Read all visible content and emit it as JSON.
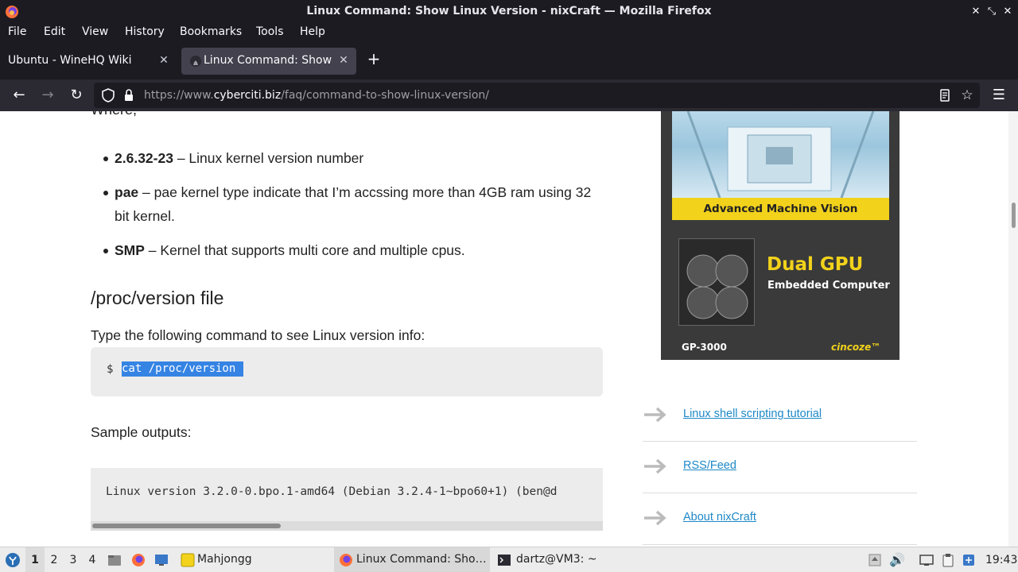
{
  "window": {
    "title": "Linux Command: Show Linux Version - nixCraft — Mozilla Firefox"
  },
  "menubar": {
    "items": [
      "File",
      "Edit",
      "View",
      "History",
      "Bookmarks",
      "Tools",
      "Help"
    ]
  },
  "tabs": [
    {
      "label": "Ubuntu - WineHQ Wiki",
      "active": false
    },
    {
      "label": "Linux Command: Show Linux Version - nixCraft",
      "active": true
    }
  ],
  "urlbar": {
    "prefix": "https://www.",
    "domain": "cyberciti.biz",
    "path": "/faq/command-to-show-linux-version/"
  },
  "article": {
    "cut_text": "Where,",
    "definitions": [
      {
        "term": "2.6.32-23",
        "desc": " – Linux kernel version number"
      },
      {
        "term": "pae",
        "desc": " – pae kernel type indicate that I’m accssing more than 4GB ram using 32 bit kernel."
      },
      {
        "term": "SMP",
        "desc": " – Kernel that supports multi core and multiple cpus."
      }
    ],
    "section_heading": "/proc/version file",
    "lead": "Type the following command to see Linux version info:",
    "prompt": "$",
    "command": "cat /proc/version",
    "sample_label": "Sample outputs:",
    "output": "Linux version 3.2.0-0.bpo.1-amd64 (Debian 3.2.4-1~bpo60+1) (ben@d"
  },
  "ad": {
    "banner": "Advanced Machine Vision",
    "headline": "Dual GPU",
    "subline": "Embedded Computer",
    "model": "GP-3000",
    "brand": "cincoze™"
  },
  "sidebar_links": [
    "Linux shell scripting tutorial",
    "RSS/Feed",
    "About nixCraft"
  ],
  "taskbar": {
    "workspaces": [
      "1",
      "2",
      "3",
      "4"
    ],
    "tasks": [
      {
        "label": "Mahjongg"
      },
      {
        "label": "Linux Command: Sho…"
      },
      {
        "label": "dartz@VM3: ~"
      }
    ],
    "clock": "19:43"
  },
  "colors": {
    "accent": "#3584e4",
    "link": "#1e88c7",
    "chrome_dark": "#1c1b22",
    "ad_yellow": "#f2d21b"
  }
}
